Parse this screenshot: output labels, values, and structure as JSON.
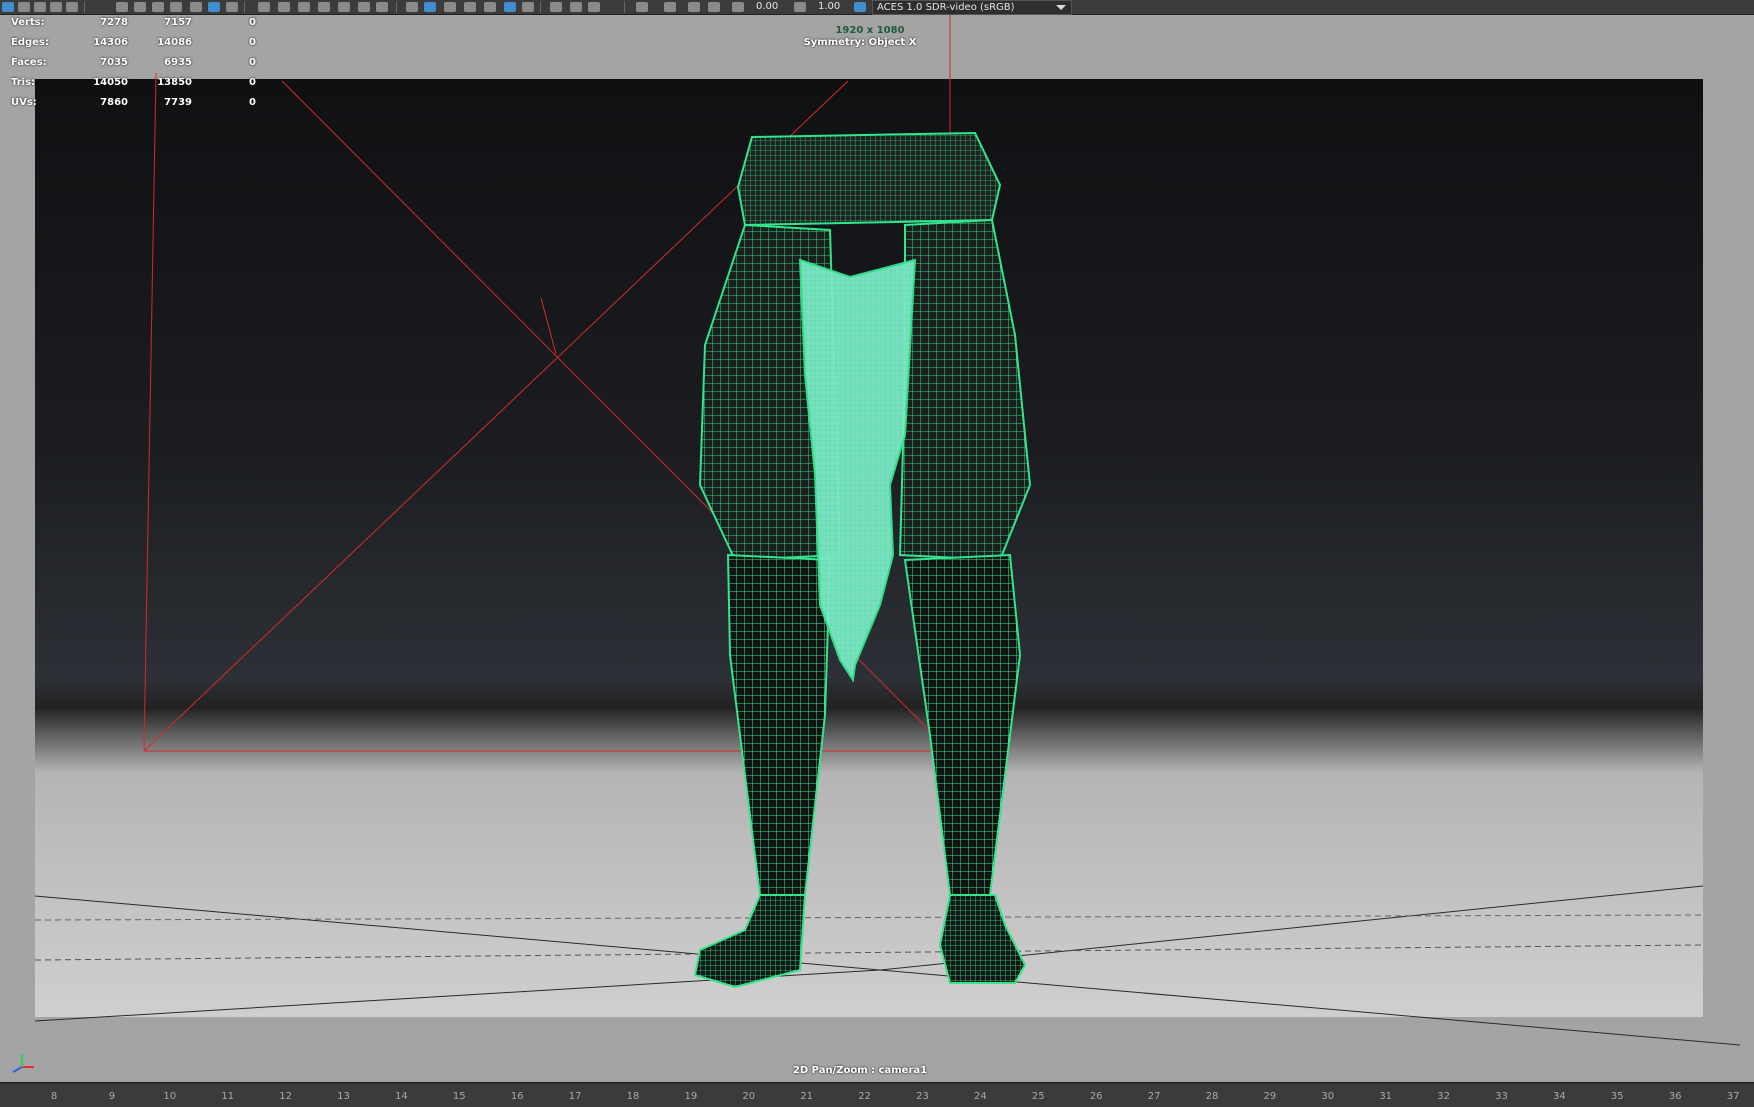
{
  "toolbar": {
    "value1": "0.00",
    "value2": "1.00",
    "color_space": "ACES 1.0 SDR-video (sRGB)"
  },
  "hud": {
    "stats": [
      {
        "label": "Verts:",
        "a": "7278",
        "b": "7157",
        "c": "0"
      },
      {
        "label": "Edges:",
        "a": "14306",
        "b": "14086",
        "c": "0"
      },
      {
        "label": "Faces:",
        "a": "7035",
        "b": "6935",
        "c": "0"
      },
      {
        "label": "Tris:",
        "a": "14050",
        "b": "13850",
        "c": "0"
      },
      {
        "label": "UVs:",
        "a": "7860",
        "b": "7739",
        "c": "0"
      }
    ],
    "resolution": "1920 x 1080",
    "symmetry": "Symmetry: Object X",
    "camera": "2D Pan/Zoom : camera1"
  },
  "timeline": {
    "ticks": [
      "8",
      "9",
      "10",
      "11",
      "12",
      "13",
      "14",
      "15",
      "16",
      "17",
      "18",
      "19",
      "20",
      "21",
      "22",
      "23",
      "24",
      "25",
      "26",
      "27",
      "28",
      "29",
      "30",
      "31",
      "32",
      "33",
      "34",
      "35",
      "36",
      "37"
    ]
  },
  "colors": {
    "wireframe": "#33e58c",
    "selection_fill": "#7fe8c8",
    "camera_guides": "#d42a2a"
  }
}
